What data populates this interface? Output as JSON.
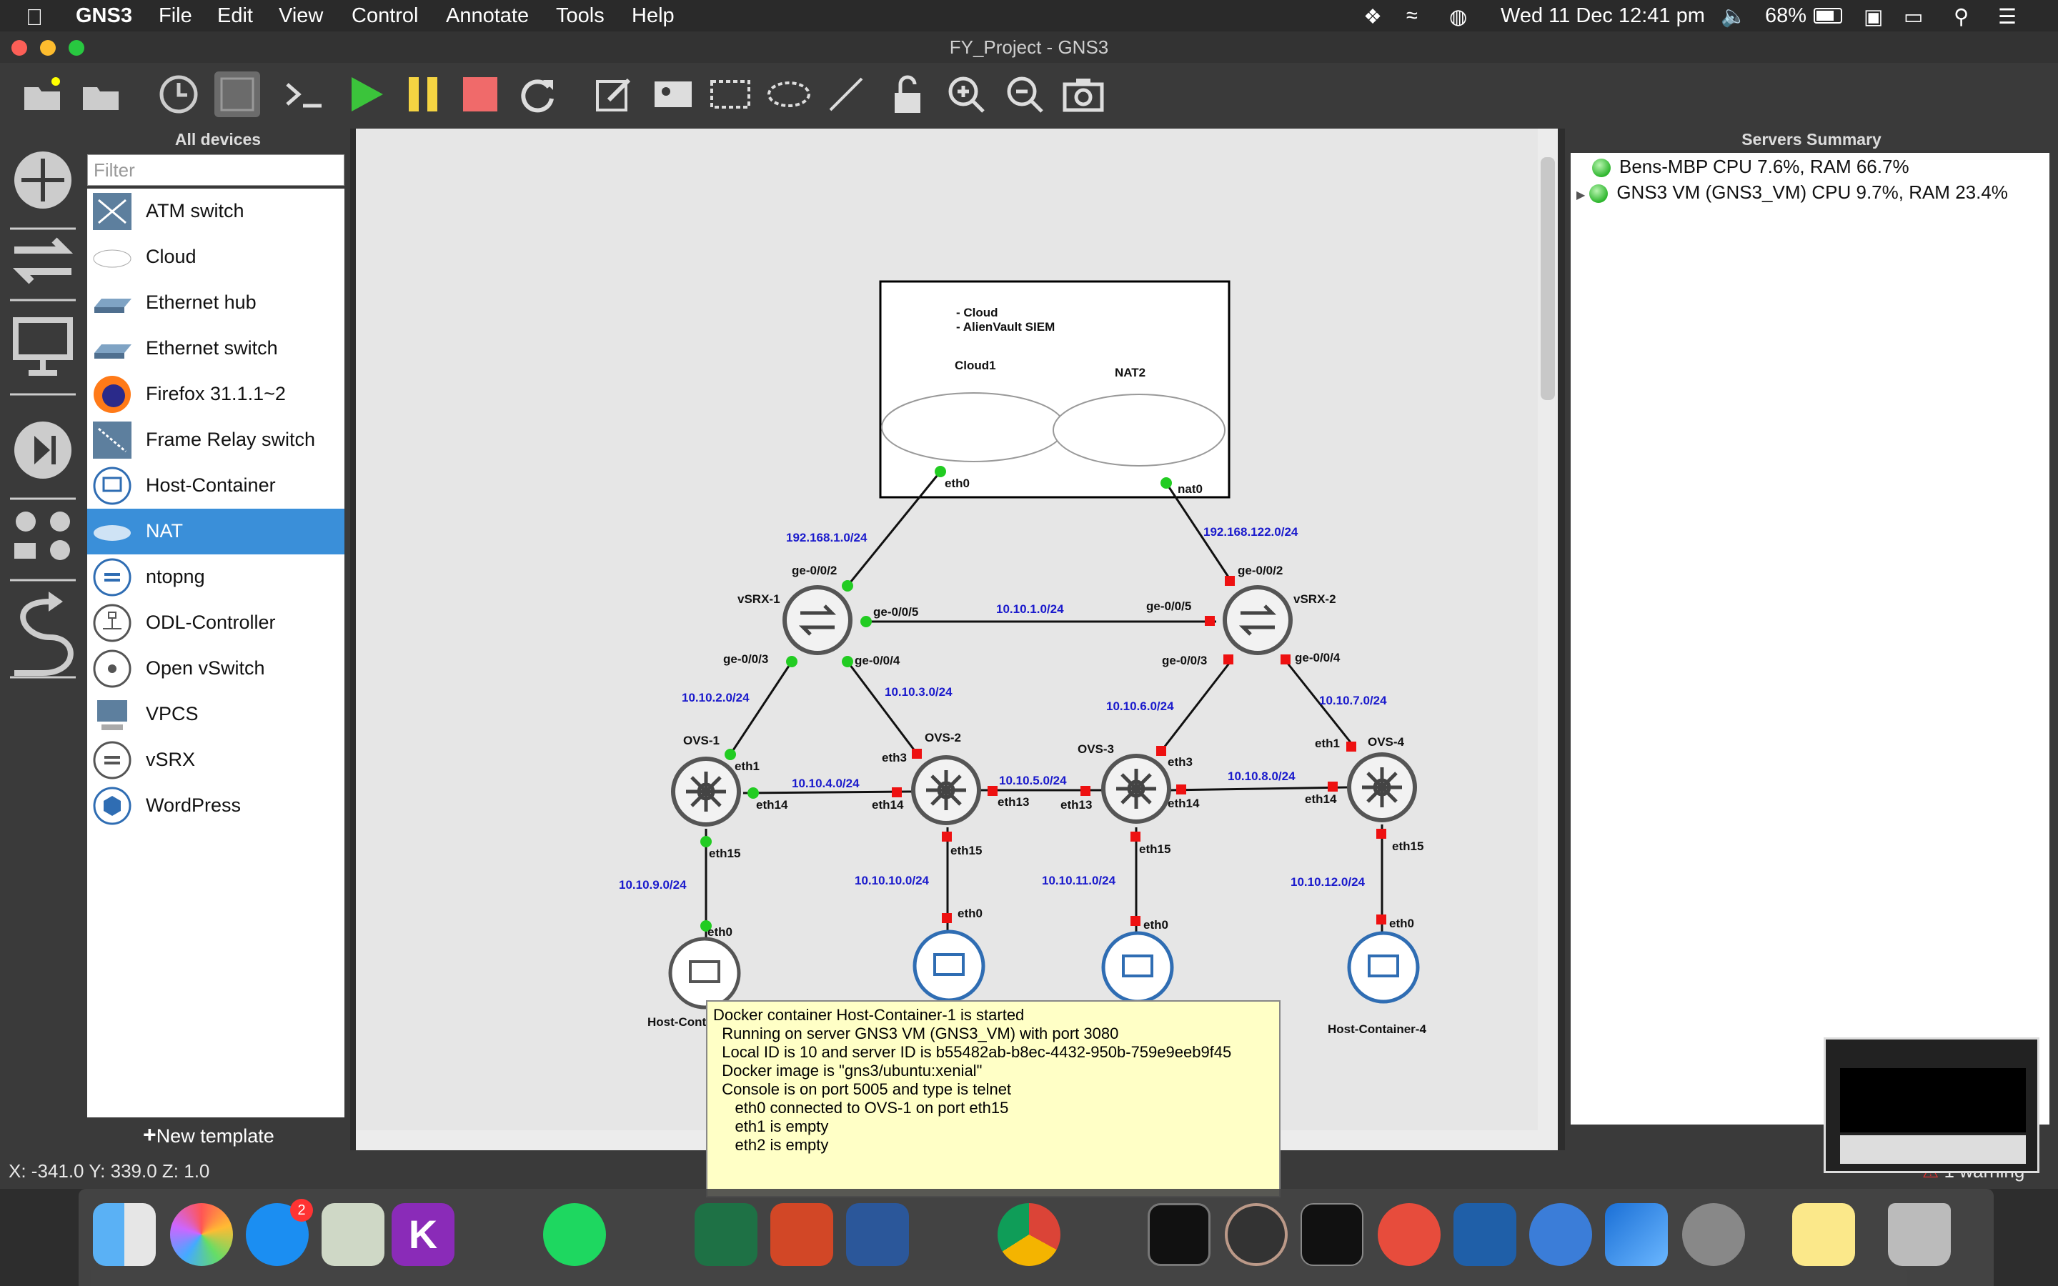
{
  "menubar": {
    "app": "GNS3",
    "items": [
      "File",
      "Edit",
      "View",
      "Control",
      "Annotate",
      "Tools",
      "Help"
    ],
    "clock": "Wed 11 Dec  12:41 pm",
    "battery": "68%"
  },
  "window": {
    "title": "FY_Project - GNS3"
  },
  "devices_panel": {
    "title": "All devices",
    "filter_placeholder": "Filter",
    "items": [
      "ATM switch",
      "Cloud",
      "Ethernet hub",
      "Ethernet switch",
      "Firefox 31.1.1~2",
      "Frame Relay switch",
      "Host-Container",
      "NAT",
      "ntopng",
      "ODL-Controller",
      "Open vSwitch",
      "VPCS",
      "vSRX",
      "WordPress"
    ],
    "selected": "NAT",
    "new_template": "New template"
  },
  "servers_panel": {
    "title": "Servers Summary",
    "servers": [
      "Bens-MBP CPU 7.6%, RAM 66.7%",
      "GNS3 VM (GNS3_VM) CPU 9.7%, RAM 23.4%"
    ]
  },
  "status": {
    "coords": "X: -341.0 Y: 339.0 Z: 1.0",
    "warning": "1 warning"
  },
  "topology": {
    "note": [
      "- Cloud",
      "- AlienVault SIEM"
    ],
    "nodes": {
      "cloud1": "Cloud1",
      "nat2": "NAT2",
      "vsrx1": "vSRX-1",
      "vsrx2": "vSRX-2",
      "ovs1": "OVS-1",
      "ovs2": "OVS-2",
      "ovs3": "OVS-3",
      "ovs4": "OVS-4",
      "host1": "Host-Cont",
      "host4": "Host-Container-4"
    },
    "ports": {
      "eth0": "eth0",
      "nat0": "nat0",
      "ge002": "ge-0/0/2",
      "ge005": "ge-0/0/5",
      "ge003": "ge-0/0/3",
      "ge004": "ge-0/0/4",
      "eth1": "eth1",
      "eth3": "eth3",
      "eth13": "eth13",
      "eth14": "eth14",
      "eth15": "eth15"
    },
    "subnets": {
      "s1": "192.168.1.0/24",
      "s2": "192.168.122.0/24",
      "s3": "10.10.1.0/24",
      "s4": "10.10.2.0/24",
      "s5": "10.10.3.0/24",
      "s6": "10.10.6.0/24",
      "s7": "10.10.7.0/24",
      "s8": "10.10.4.0/24",
      "s9": "10.10.5.0/24",
      "s10": "10.10.8.0/24",
      "s11": "10.10.9.0/24",
      "s12": "10.10.10.0/24",
      "s13": "10.10.11.0/24",
      "s14": "10.10.12.0/24"
    }
  },
  "tooltip": [
    "Docker container Host-Container-1 is started",
    "  Running on server GNS3 VM (GNS3_VM) with port 3080",
    "  Local ID is 10 and server ID is b55482ab-b8ec-4432-950b-759e9eeb9f45",
    "  Docker image is \"gns3/ubuntu:xenial\"",
    "  Console is on port 5005 and type is telnet",
    "     eth0 connected to OVS-1 on port eth15",
    "     eth1 is empty",
    "     eth2 is empty"
  ],
  "dock": {
    "appstore_badge": "2"
  },
  "colors": {
    "selection": "#3a8fd9",
    "link_up": "#22cc22",
    "link_down": "#ee1111",
    "subnet_label": "#1a1acc",
    "tooltip_bg": "#ffffc6"
  }
}
